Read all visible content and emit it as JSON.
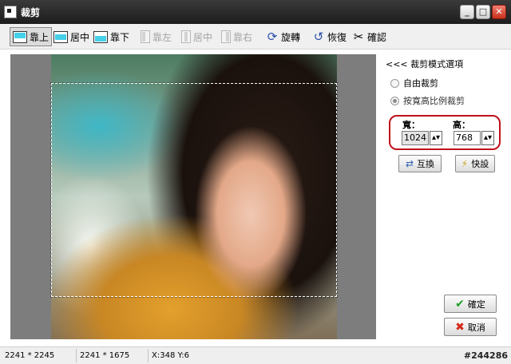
{
  "window": {
    "title": "裁剪"
  },
  "toolbar": {
    "align_top": "靠上",
    "align_middle": "居中",
    "align_bottom": "靠下",
    "align_left": "靠左",
    "align_center": "居中",
    "align_right": "靠右",
    "rotate": "旋轉",
    "restore": "恢復",
    "confirm": "確認"
  },
  "panel": {
    "header": "<<< 裁剪模式選項",
    "free_crop": "自由裁剪",
    "ratio_crop": "按寬高比例裁剪",
    "width_label": "寬：",
    "height_label": "高：",
    "width_value": "1024",
    "height_value": "768",
    "swap_button": "互換",
    "preset_button": "快設",
    "ok_button": "確定",
    "cancel_button": "取消"
  },
  "status": {
    "original_size": "2241 * 2245",
    "crop_size": "2241 * 1675",
    "cursor": "X:348 Y:6",
    "image_id": "#244286"
  },
  "icons": {
    "rotate": "rotate-icon",
    "restore": "restore-icon",
    "confirm": "scissors-icon"
  },
  "colors": {
    "highlight_border": "#c0101a",
    "align_fill": "#45d0e8"
  }
}
